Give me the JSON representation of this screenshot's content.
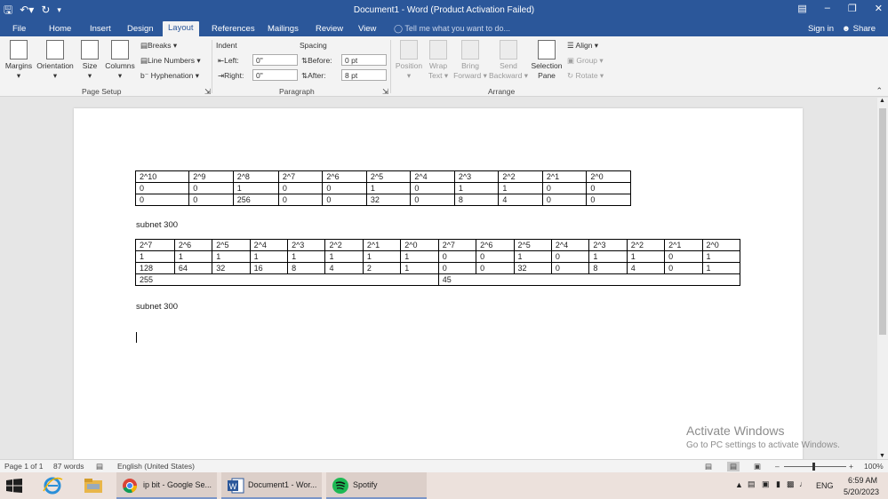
{
  "app": {
    "title": "Document1 - Word (Product Activation Failed)"
  },
  "tabs": [
    {
      "label": "File"
    },
    {
      "label": "Home"
    },
    {
      "label": "Insert"
    },
    {
      "label": "Design"
    },
    {
      "label": "Layout"
    },
    {
      "label": "References"
    },
    {
      "label": "Mailings"
    },
    {
      "label": "Review"
    },
    {
      "label": "View"
    }
  ],
  "tell_me": "Tell me what you want to do...",
  "sign_in": "Sign in",
  "share": "Share",
  "ribbon": {
    "page_setup": {
      "margins": "Margins",
      "orientation": "Orientation",
      "size": "Size",
      "columns": "Columns",
      "breaks": "Breaks",
      "line_numbers": "Line Numbers",
      "hyphenation": "Hyphenation",
      "label": "Page Setup"
    },
    "paragraph": {
      "indent": "Indent",
      "left_label": "Left:",
      "left_value": "0\"",
      "right_label": "Right:",
      "right_value": "0\"",
      "spacing": "Spacing",
      "before_label": "Before:",
      "before_value": "0 pt",
      "after_label": "After:",
      "after_value": "8 pt",
      "label": "Paragraph"
    },
    "arrange": {
      "position": "Position",
      "wrap_text_1": "Wrap",
      "wrap_text_2": "Text",
      "bring_forward_1": "Bring",
      "bring_forward_2": "Forward",
      "send_backward_1": "Send",
      "send_backward_2": "Backward",
      "selection_pane_1": "Selection",
      "selection_pane_2": "Pane",
      "align": "Align",
      "group": "Group",
      "rotate": "Rotate",
      "label": "Arrange"
    }
  },
  "document": {
    "table1": [
      [
        "2^10",
        "2^9",
        "2^8",
        "2^7",
        "2^6",
        "2^5",
        "2^4",
        "2^3",
        "2^2",
        "2^1",
        "2^0"
      ],
      [
        "0",
        "0",
        "1",
        "0",
        "0",
        "1",
        "0",
        "1",
        "1",
        "0",
        "0"
      ],
      [
        "0",
        "0",
        "256",
        "0",
        "0",
        "32",
        "0",
        "8",
        "4",
        "0",
        "0"
      ]
    ],
    "para1": "subnet 300",
    "table2": {
      "header": [
        "2^7",
        "2^6",
        "2^5",
        "2^4",
        "2^3",
        "2^2",
        "2^1",
        "2^0",
        "2^7",
        "2^6",
        "2^5",
        "2^4",
        "2^3",
        "2^2",
        "2^1",
        "2^0"
      ],
      "bits": [
        "1",
        "1",
        "1",
        "1",
        "1",
        "1",
        "1",
        "1",
        "0",
        "0",
        "1",
        "0",
        "1",
        "1",
        "0",
        "1"
      ],
      "values": [
        "128",
        "64",
        "32",
        "16",
        "8",
        "4",
        "2",
        "1",
        "0",
        "0",
        "32",
        "0",
        "8",
        "4",
        "0",
        "1"
      ],
      "sum_left": "255",
      "sum_right": "45"
    },
    "para2": "subnet 300"
  },
  "watermark": {
    "line1": "Activate Windows",
    "line2": "Go to PC settings to activate Windows."
  },
  "status": {
    "page": "Page 1 of 1",
    "words": "87 words",
    "language": "English (United States)",
    "zoom": "100%"
  },
  "taskbar": {
    "chrome": "ip bit - Google Se...",
    "word": "Document1 - Wor...",
    "spotify": "Spotify",
    "lang": "ENG",
    "time": "6:59 AM",
    "date": "5/20/2023"
  }
}
